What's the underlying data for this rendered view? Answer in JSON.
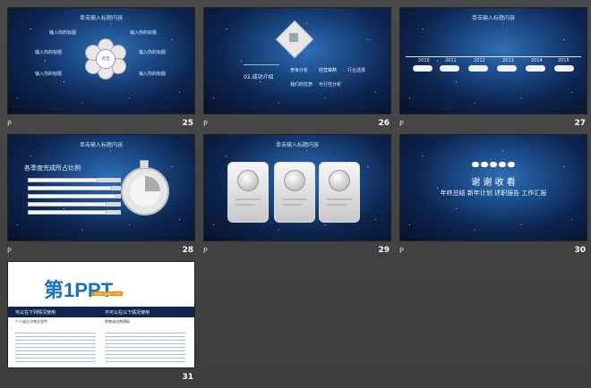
{
  "slides": [
    {
      "num": "25",
      "note": "P",
      "title": "单击输入标题内容",
      "center": "点击",
      "items": [
        "输入你的标题",
        "输入你的标题",
        "输入你的标题",
        "输入你的标题",
        "输入你的标题",
        "输入你的标题"
      ]
    },
    {
      "num": "26",
      "note": "P",
      "title": "",
      "heading": "02.成功介绍",
      "bullets": [
        "竞争分析",
        "我们的优势",
        "经营策略",
        "行业选择",
        "可行性分析"
      ]
    },
    {
      "num": "27",
      "note": "P",
      "title": "单击输入标题内容",
      "years": [
        "2010",
        "2011",
        "2012",
        "2013",
        "2014",
        "2015"
      ]
    },
    {
      "num": "28",
      "note": "P",
      "title": "单击输入标题内容",
      "heading": "各季度完成所占比例",
      "bar_values": [
        0.75,
        0.9,
        0.95,
        0.85,
        0.85
      ]
    },
    {
      "num": "29",
      "note": "P",
      "title": "单击输入标题内容"
    },
    {
      "num": "30",
      "note": "P",
      "title": "",
      "thanks": "谢 谢 收 看",
      "subtitle": "年终总结  新年计划  述职报告  工作汇报"
    },
    {
      "num": "31",
      "logo": "第1PPT",
      "site": "www.1ppt.com",
      "col1_title": "可以在下列情况使用",
      "col2_title": "不可以在以下情况使用",
      "col1_line1": "个人或企业商业宣传",
      "col2_line1": "转售或出售模板"
    }
  ],
  "colors": {
    "background": "#444444",
    "slide_bg": "#0d2550",
    "accent": "#2f6fb8",
    "logo_blue": "#1b6fc4",
    "logo_orange": "#f08a00"
  }
}
